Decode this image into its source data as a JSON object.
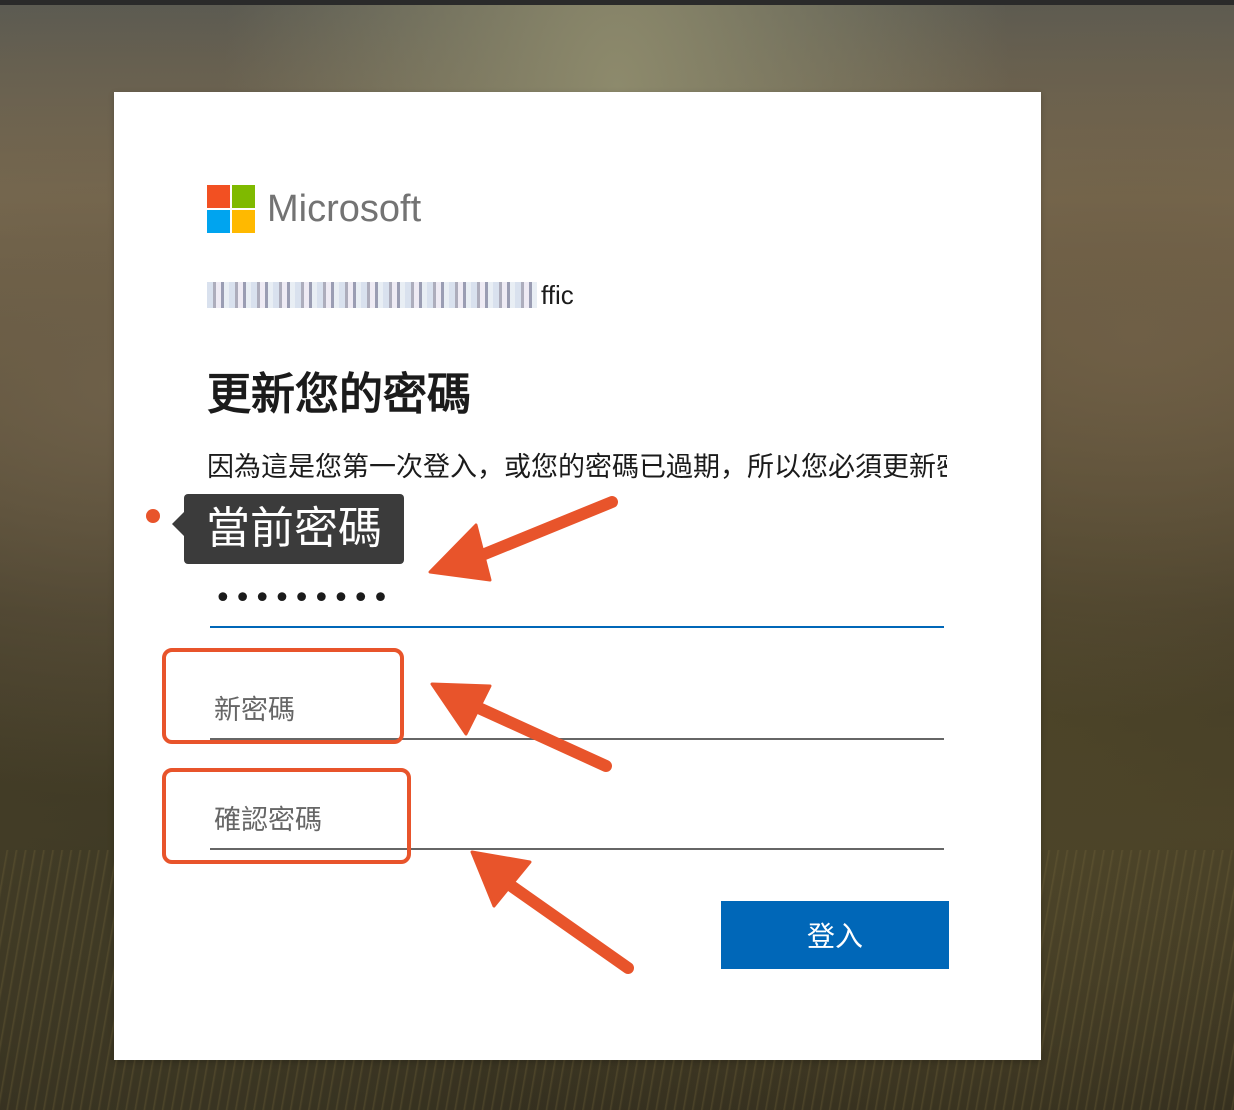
{
  "brand": {
    "name": "Microsoft"
  },
  "account": {
    "email_visible_fragment": "ffic"
  },
  "page": {
    "title": "更新您的密碼",
    "description": "因為這是您第一次登入，或您的密碼已過期，所以您必須更新密碼。"
  },
  "tooltip": {
    "label": "當前密碼"
  },
  "form": {
    "current_password": {
      "value": "•••••••••"
    },
    "new_password": {
      "placeholder": "新密碼"
    },
    "confirm_password": {
      "placeholder": "確認密碼"
    },
    "submit_label": "登入"
  },
  "colors": {
    "accent": "#0067b8",
    "annotation": "#e8542b",
    "logo": [
      "#f25022",
      "#7fba00",
      "#00a4ef",
      "#ffb900"
    ]
  },
  "icons": [
    "microsoft-logo-icon",
    "annotation-arrow-icon"
  ]
}
